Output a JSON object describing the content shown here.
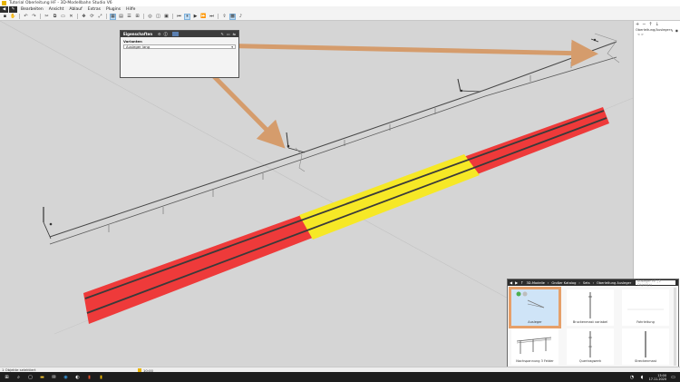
{
  "window": {
    "title": "Tutorial Oberleitung HF - 3D-Modellbahn Studio V6"
  },
  "menubar": {
    "nav_back": "◀",
    "nav_edit": "✎",
    "items": [
      "Bearbeiten",
      "Ansicht",
      "Ablauf",
      "Extras",
      "Plugins",
      "Hilfe"
    ]
  },
  "properties_panel": {
    "title": "Eigenschaften",
    "section_label": "Varianten",
    "variant_value": "Ausleger lang"
  },
  "right_panel": {
    "row_label": "Oberleitung/Ausleger",
    "sub_label": "< >"
  },
  "catalog": {
    "breadcrumb": [
      "3D-Modelle",
      "Großer Katalog",
      "Sets",
      "Oberleitung Ausleger"
    ],
    "search_placeholder": "Ausleger HF | 2 Objekt(e)",
    "items": [
      {
        "label": "Ausleger",
        "selected": true
      },
      {
        "label": "Bruckenmast variabel",
        "selected": false
      },
      {
        "label": "Fahrleitung",
        "selected": false
      },
      {
        "label": "Nachspannung 3 Felder",
        "selected": false
      },
      {
        "label": "Quertragwerk",
        "selected": false
      },
      {
        "label": "Streckenmast",
        "selected": false
      }
    ]
  },
  "statusbar": {
    "left": "1 Objekte selektiert",
    "mid": "10:00"
  },
  "taskbar": {
    "time": "13:00",
    "date": "17.11.2020"
  },
  "colors": {
    "track_red": "#ee3a3a",
    "track_yellow": "#f6e826",
    "arrow": "#d59c6c",
    "catalog_selected": "#e6a06a"
  }
}
